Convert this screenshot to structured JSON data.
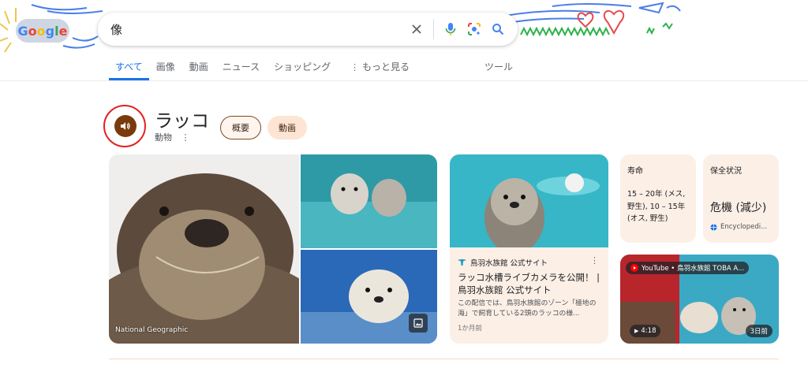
{
  "logo": {
    "letters": [
      "G",
      "o",
      "o",
      "g",
      "l",
      "e"
    ]
  },
  "search": {
    "query": "像"
  },
  "icons": {
    "clear": "close-icon",
    "voice": "microphone-icon",
    "lens": "camera-lens-icon",
    "search": "search-icon"
  },
  "tabs": [
    {
      "label": "すべて",
      "active": true
    },
    {
      "label": "画像"
    },
    {
      "label": "動画"
    },
    {
      "label": "ニュース"
    },
    {
      "label": "ショッピング"
    },
    {
      "label": "もっと見る"
    }
  ],
  "tools_label": "ツール",
  "entity": {
    "title": "ラッコ",
    "subtitle": "動物",
    "pills": [
      "概要",
      "動画"
    ]
  },
  "gallery": {
    "credit": "National Geographic"
  },
  "article": {
    "source": "鳥羽水族館 公式サイト",
    "title": "ラッコ水槽ライブカメラを公開！ | 鳥羽水族館 公式サイト",
    "snippet": "この配信では、鳥羽水族館のゾーン「極地の海」で飼育している2頭のラッコの様...",
    "date": "1か月前"
  },
  "facts": [
    {
      "label": "寿命",
      "value": "15 – 20年 (メス, 野生), 10 – 15年 (オス, 野生)"
    },
    {
      "label": "保全状況",
      "value": "危機 (減少)",
      "source": "Encyclopedi..."
    }
  ],
  "video": {
    "channel": "YouTube • 鳥羽水族館 TOBA A...",
    "duration": "4:18",
    "age": "3日前"
  },
  "colors": {
    "accent": "#1a73e8",
    "brand_brown": "#7a3a0c",
    "card_bg": "#fcefe6",
    "ring": "#e32020"
  }
}
